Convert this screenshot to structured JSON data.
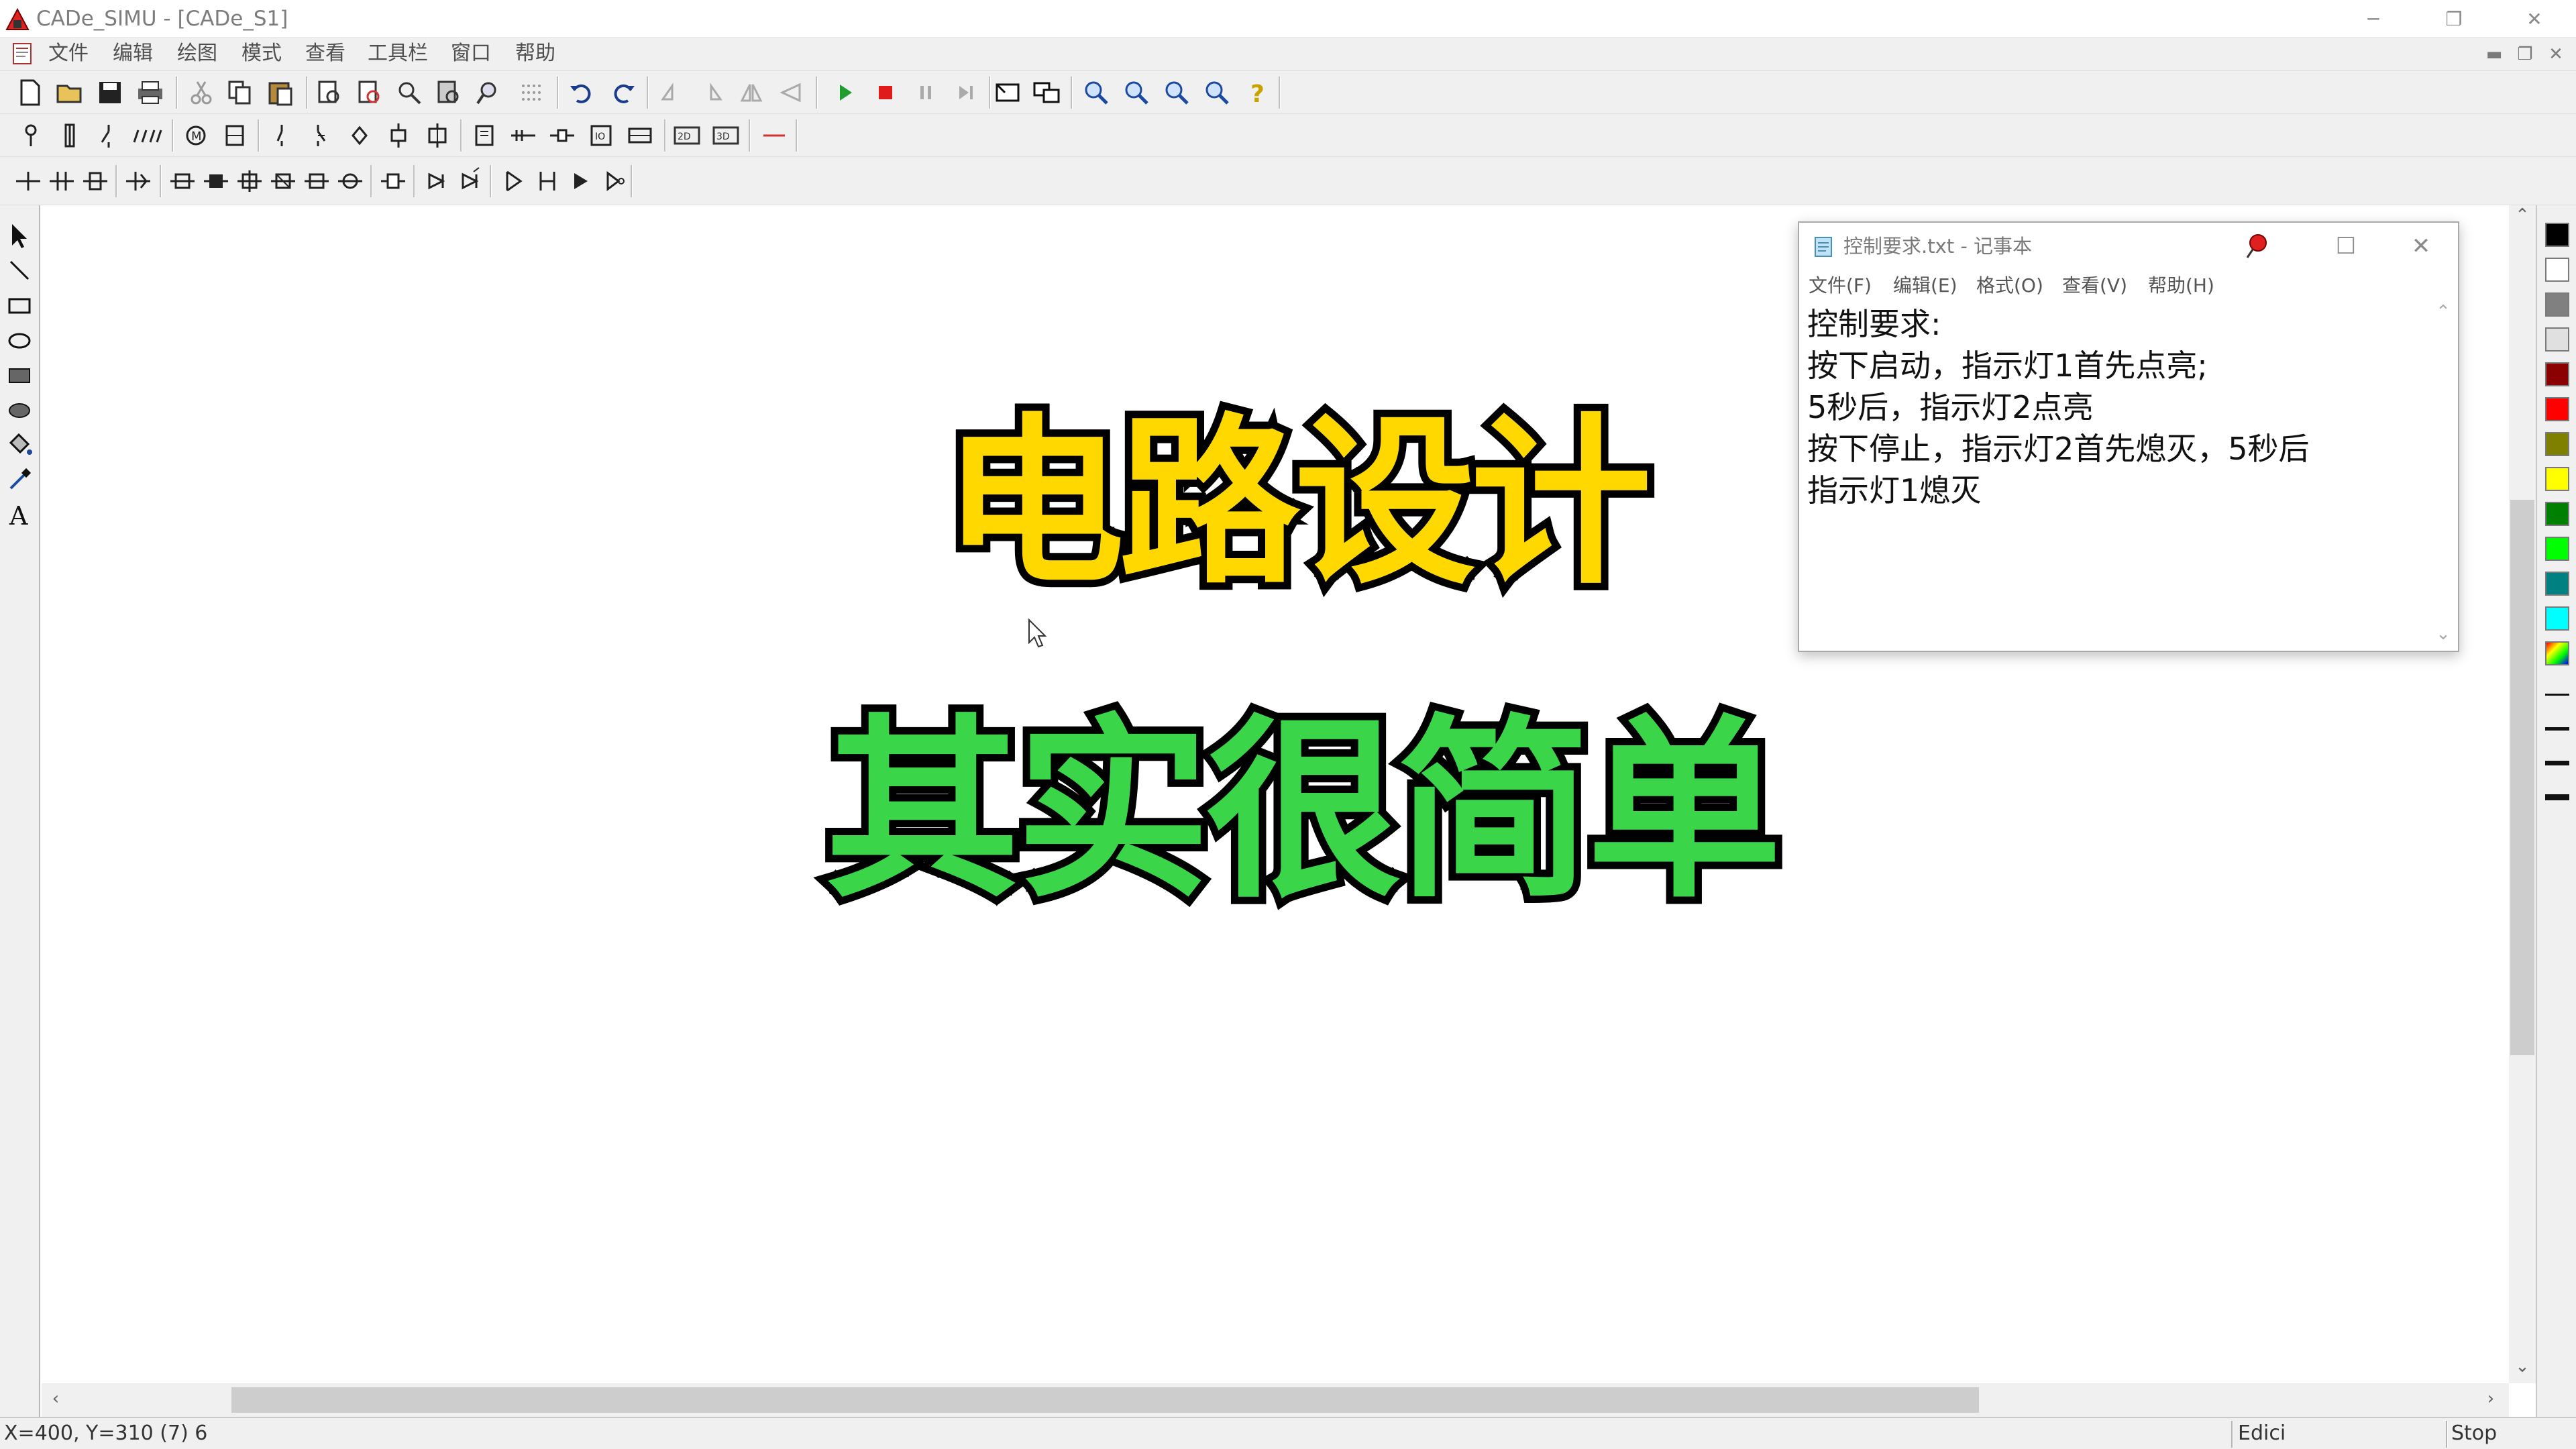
{
  "app": {
    "title": "CADe_SIMU - [CADe_S1]",
    "window_controls": [
      "minimize-icon",
      "restore-icon",
      "close-icon"
    ]
  },
  "menu": {
    "items": [
      "文件",
      "编辑",
      "绘图",
      "模式",
      "查看",
      "工具栏",
      "窗口",
      "帮助"
    ]
  },
  "overlay": {
    "line1": "电路设计",
    "line2": "其实很简单",
    "line1_color": "#ffd800",
    "line2_color": "#3bd54a"
  },
  "notepad": {
    "title": "控制要求.txt - 记事本",
    "menu": [
      "文件(F)",
      "编辑(E)",
      "格式(O)",
      "查看(V)",
      "帮助(H)"
    ],
    "lines": [
      "控制要求:",
      "按下启动，指示灯1首先点亮;",
      "5秒后，指示灯2点亮",
      "按下停止，指示灯2首先熄灭，5秒后",
      "指示灯1熄灭"
    ]
  },
  "palette": {
    "colors": [
      "#000000",
      "#ffffff",
      "#808080",
      "#e0e0e0",
      "#8b0000",
      "#ff0000",
      "#808000",
      "#ffff00",
      "#008000",
      "#00ff00",
      "#008080",
      "#00ffff"
    ]
  },
  "status": {
    "coords": "X=400, Y=310 (7) 6",
    "mode": "Edici",
    "run_state": "Stop"
  }
}
